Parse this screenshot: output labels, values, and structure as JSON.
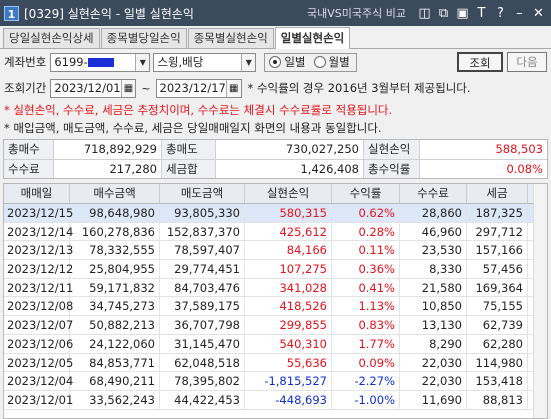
{
  "window": {
    "code": "[0329]",
    "title": "[0329] 실현손익 - 일별 실현손익",
    "link": "국내VS미국주식 비교",
    "icons": [
      "pin-icon",
      "copy-icon",
      "link-icon",
      "font-icon",
      "help-icon",
      "minimize-icon",
      "close-icon"
    ]
  },
  "tabs": [
    "당일실현손익상세",
    "종목별당일손익",
    "종목별실현손익",
    "일별실현손익"
  ],
  "filter": {
    "account_label": "계좌번호",
    "account_value": "6199-",
    "account_name": "스윙,배당",
    "radio_daily": "일별",
    "radio_monthly": "월별",
    "search_button": "조회",
    "next_button": "다음",
    "period_label": "조회기간",
    "date_from": "2023/12/01",
    "date_sep": "~",
    "date_to": "2023/12/17",
    "period_note": "* 수익률의 경우 2016년 3월부터 제공됩니다."
  },
  "notes": {
    "line1": "* 실현손익, 수수료, 세금은 추정치이며, 수수료는 체결시 수수료률로 적용됩니다.",
    "line2": "* 매입금액, 매도금액, 수수료, 세금은 당일매매일지 화면의 내용과 동일합니다."
  },
  "summary": {
    "buy_total_label": "총매수",
    "buy_total": "718,892,929",
    "sell_total_label": "총매도",
    "sell_total": "730,027,250",
    "pnl_label": "실현손익",
    "pnl": "588,503",
    "fee_label": "수수료",
    "fee": "217,280",
    "tax_label": "세금합",
    "tax": "1,426,408",
    "rate_label": "총수익률",
    "rate": "0.08%"
  },
  "table": {
    "headers": [
      "매매일",
      "매수금액",
      "매도금액",
      "실현손익",
      "수익률",
      "수수료",
      "세금"
    ],
    "rows": [
      [
        "2023/12/15",
        "98,648,980",
        "93,805,330",
        "580,315",
        "0.62%",
        "28,860",
        "187,325"
      ],
      [
        "2023/12/14",
        "160,278,836",
        "152,837,370",
        "425,612",
        "0.28%",
        "46,960",
        "297,712"
      ],
      [
        "2023/12/13",
        "78,332,555",
        "78,597,407",
        "84,166",
        "0.11%",
        "23,530",
        "157,166"
      ],
      [
        "2023/12/12",
        "25,804,955",
        "29,774,451",
        "107,275",
        "0.36%",
        "8,330",
        "57,456"
      ],
      [
        "2023/12/11",
        "59,171,832",
        "84,703,476",
        "341,028",
        "0.41%",
        "21,580",
        "169,364"
      ],
      [
        "2023/12/08",
        "34,745,273",
        "37,589,175",
        "418,526",
        "1.13%",
        "10,850",
        "75,155"
      ],
      [
        "2023/12/07",
        "50,882,213",
        "36,707,798",
        "299,855",
        "0.83%",
        "13,130",
        "62,739"
      ],
      [
        "2023/12/06",
        "24,122,060",
        "31,145,470",
        "540,310",
        "1.77%",
        "8,290",
        "62,280"
      ],
      [
        "2023/12/05",
        "84,853,771",
        "62,048,518",
        "55,636",
        "0.09%",
        "22,030",
        "114,980"
      ],
      [
        "2023/12/04",
        "68,490,211",
        "78,395,802",
        "-1,815,527",
        "-2.27%",
        "22,030",
        "153,418"
      ],
      [
        "2023/12/01",
        "33,562,243",
        "44,422,453",
        "-448,693",
        "-1.00%",
        "11,690",
        "88,813"
      ]
    ]
  },
  "colors": {
    "positive": "#e8101a",
    "negative": "#1030d0",
    "selected_row": "#dce8f7"
  }
}
